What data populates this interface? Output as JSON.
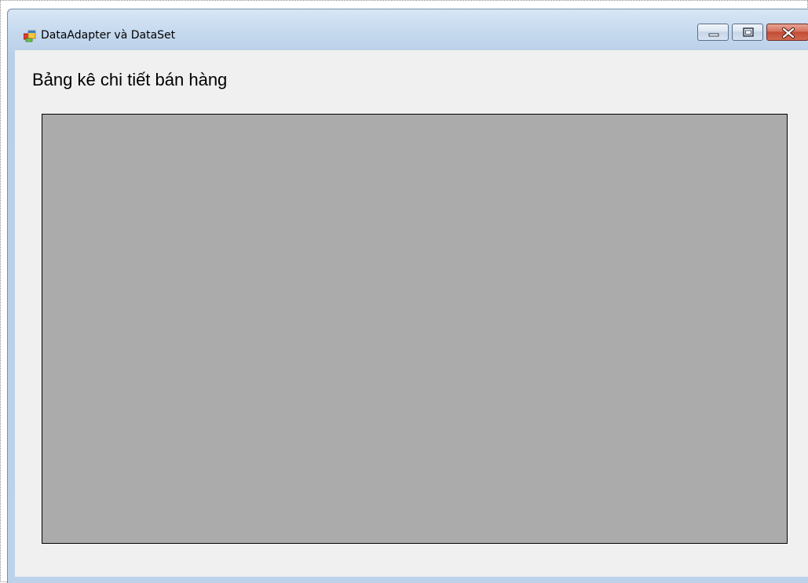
{
  "window": {
    "title": "DataAdapter và DataSet",
    "icons": {
      "app": "form-icon",
      "minimize": "minimize-icon",
      "maximize": "maximize-icon",
      "close": "close-icon"
    }
  },
  "form": {
    "heading": "Bảng kê chi tiết bán hàng"
  },
  "colors": {
    "grid_background": "#ababab",
    "form_background": "#f0f0f0",
    "close_button": "#c24b34"
  }
}
